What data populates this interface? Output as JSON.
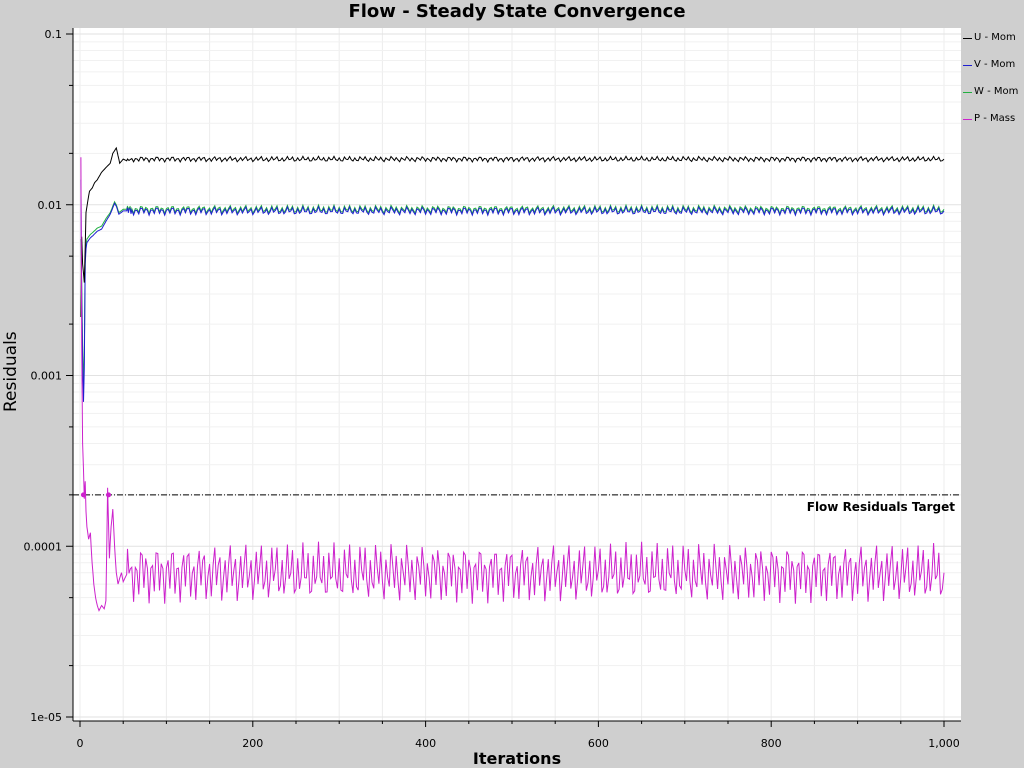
{
  "window": {
    "title": "Flow - Steady State Convergence"
  },
  "chart_data": {
    "type": "line",
    "title": "Flow - Steady State Convergence",
    "xlabel": "Iterations",
    "ylabel": "Residuals",
    "xlim": [
      0,
      1000
    ],
    "ylim": [
      1e-05,
      0.1
    ],
    "yscale": "log",
    "x_ticks": [
      0,
      200,
      400,
      600,
      800,
      1000
    ],
    "x_tick_labels": [
      "0",
      "200",
      "400",
      "600",
      "800",
      "1,000"
    ],
    "y_ticks": [
      0.1,
      0.01,
      0.001,
      0.0001,
      1e-05
    ],
    "y_tick_labels": [
      "0.1",
      "0.01",
      "0.001",
      "0.0001",
      "1e-05"
    ],
    "grid": true,
    "legend_position": "top-right",
    "reference_line": {
      "label": "Flow Residuals Target",
      "value": 0.0002
    },
    "series": [
      {
        "name": "U - Mom",
        "color": "#000000",
        "x": [
          1,
          2,
          3,
          5,
          7,
          9,
          11,
          14,
          17,
          20,
          25,
          30,
          35,
          38,
          42,
          46,
          50,
          55,
          60,
          100,
          200,
          400,
          600,
          800,
          1000
        ],
        "y": [
          0.0022,
          0.0065,
          0.0045,
          0.0035,
          0.009,
          0.0105,
          0.012,
          0.0125,
          0.0135,
          0.014,
          0.0155,
          0.0165,
          0.0175,
          0.02,
          0.0215,
          0.0175,
          0.0185,
          0.018,
          0.0185,
          0.0185,
          0.0185,
          0.0185,
          0.0185,
          0.0185,
          0.0185
        ]
      },
      {
        "name": "V - Mom",
        "color": "#1f1fd0",
        "x": [
          1,
          2,
          3,
          4,
          5,
          6,
          7,
          8,
          10,
          12,
          15,
          20,
          25,
          30,
          35,
          40,
          42,
          45,
          50,
          60,
          100,
          200,
          400,
          600,
          800,
          1000
        ],
        "y": [
          0.014,
          0.0028,
          0.0012,
          0.0007,
          0.0011,
          0.0045,
          0.0055,
          0.006,
          0.0062,
          0.0064,
          0.0066,
          0.007,
          0.0072,
          0.008,
          0.0088,
          0.0102,
          0.0098,
          0.0088,
          0.0092,
          0.0092,
          0.0092,
          0.0092,
          0.0092,
          0.0092,
          0.0092,
          0.0092
        ]
      },
      {
        "name": "W - Mom",
        "color": "#22b040",
        "x": [
          1,
          2,
          3,
          4,
          5,
          6,
          7,
          8,
          10,
          12,
          15,
          20,
          25,
          30,
          35,
          40,
          42,
          45,
          50,
          60,
          100,
          200,
          400,
          600,
          800,
          1000
        ],
        "y": [
          0.0063,
          0.0035,
          0.0015,
          0.0009,
          0.0013,
          0.0048,
          0.0058,
          0.0063,
          0.0065,
          0.0067,
          0.0069,
          0.0073,
          0.0075,
          0.0083,
          0.009,
          0.0104,
          0.01,
          0.009,
          0.0094,
          0.0094,
          0.0094,
          0.0094,
          0.0094,
          0.0094,
          0.0094,
          0.0094
        ]
      },
      {
        "name": "P - Mass",
        "color": "#cc22cc",
        "x": [
          1,
          2,
          3,
          4,
          5,
          6,
          7,
          8,
          10,
          12,
          14,
          16,
          18,
          20,
          22,
          25,
          28,
          30,
          32,
          34,
          36,
          38,
          40,
          42,
          44,
          46,
          48,
          50,
          55,
          60,
          100,
          200,
          400,
          600,
          800,
          1000
        ],
        "y": [
          0.019,
          0.0015,
          0.0004,
          0.00028,
          0.00019,
          0.00024,
          0.00016,
          0.00013,
          0.00011,
          0.00012,
          8e-05,
          6e-05,
          5e-05,
          4.5e-05,
          4.2e-05,
          4.5e-05,
          4.3e-05,
          4.8e-05,
          0.00022,
          8.5e-05,
          0.00013,
          0.000165,
          0.0001,
          7e-05,
          6e-05,
          6.5e-05,
          7e-05,
          6.2e-05,
          7e-05,
          7e-05,
          7e-05,
          7e-05,
          7e-05,
          7e-05,
          7e-05,
          7e-05
        ]
      }
    ]
  }
}
